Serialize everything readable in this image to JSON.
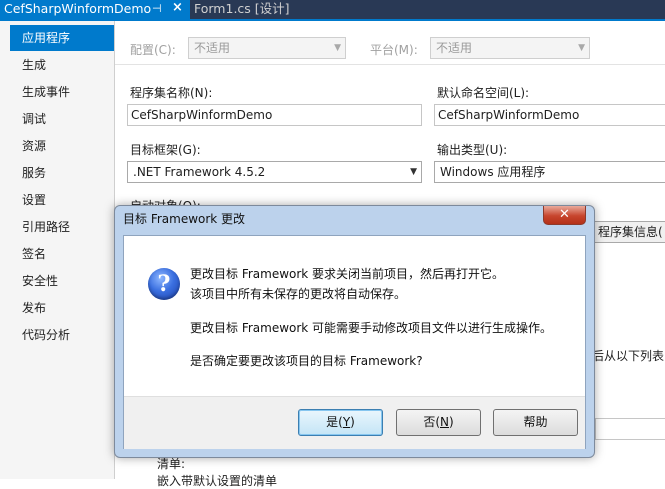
{
  "tabs": [
    {
      "label": "CefSharpWinformDemo",
      "pin": "⊣",
      "close": "×"
    },
    {
      "label": "Form1.cs [设计]"
    }
  ],
  "sidebar": {
    "items": [
      {
        "label": "应用程序"
      },
      {
        "label": "生成"
      },
      {
        "label": "生成事件"
      },
      {
        "label": "调试"
      },
      {
        "label": "资源"
      },
      {
        "label": "服务"
      },
      {
        "label": "设置"
      },
      {
        "label": "引用路径"
      },
      {
        "label": "签名"
      },
      {
        "label": "安全性"
      },
      {
        "label": "发布"
      },
      {
        "label": "代码分析"
      }
    ]
  },
  "page": {
    "config_label": "配置(C):",
    "config_value": "不适用",
    "platform_label": "平台(M):",
    "platform_value": "不适用",
    "assembly_name_label": "程序集名称(N):",
    "assembly_name_value": "CefSharpWinformDemo",
    "namespace_label": "默认命名空间(L):",
    "namespace_value": "CefSharpWinformDemo",
    "target_framework_label": "目标框架(G):",
    "target_framework_value": ".NET Framework 4.5.2",
    "output_type_label": "输出类型(U):",
    "output_type_value": "Windows 应用程序",
    "startup_label": "启动对象(O):",
    "assembly_info_button": "程序集信息(",
    "partial_right_text": "后从以下列表中",
    "partial_bottom_text1": "清单:",
    "partial_bottom_text2": "嵌入带默认设置的清单"
  },
  "dialog": {
    "title": "目标 Framework 更改",
    "close": "✕",
    "icon_glyph": "?",
    "line1": "更改目标 Framework 要求关闭当前项目，然后再打开它。",
    "line2": "该项目中所有未保存的更改将自动保存。",
    "line3": "更改目标 Framework 可能需要手动修改项目文件以进行生成操作。",
    "line4": "是否确定要更改该项目的目标 Framework?",
    "yes_pre": "是(",
    "yes_key": "Y",
    "post": ")",
    "no_pre": "否(",
    "no_key": "N",
    "help": "帮助"
  },
  "colors": {
    "accent": "#007acc",
    "tab_bar": "#293955",
    "dialog_frame": "#bcd2ec",
    "close_button": "#c7452d"
  },
  "icons": {
    "pin": "pin-icon",
    "tab_close": "close-icon",
    "dialog_close": "close-icon",
    "message": "question-icon",
    "dropdown": "chevron-down-icon"
  }
}
